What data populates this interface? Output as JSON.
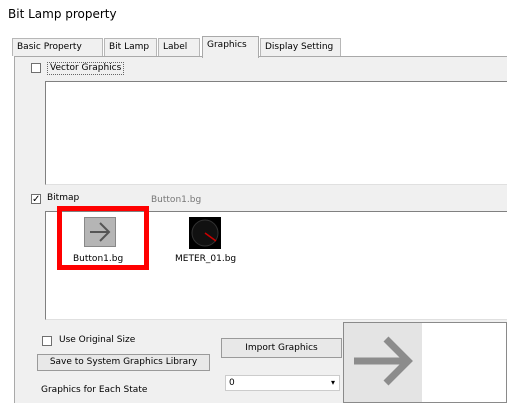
{
  "window": {
    "title": "Bit Lamp property"
  },
  "tabs": [
    {
      "label": "Basic Property",
      "active": false
    },
    {
      "label": "Bit Lamp",
      "active": false
    },
    {
      "label": "Label",
      "active": false
    },
    {
      "label": "Graphics",
      "active": true
    },
    {
      "label": "Display Setting",
      "active": false
    }
  ],
  "vector_graphics": {
    "label": "Vector Graphics",
    "checked": false
  },
  "bitmap": {
    "label": "Bitmap",
    "checked": true,
    "selected_file": "Button1.bg",
    "items": [
      {
        "name": "Button1.bg",
        "icon": "arrow-right-icon",
        "selected": true
      },
      {
        "name": "METER_01.bg",
        "icon": "meter-icon",
        "selected": false
      }
    ]
  },
  "options": {
    "use_original_size_label": "Use Original Size",
    "use_original_size_checked": false,
    "save_button_label": "Save to System Graphics Library",
    "import_button_label": "Import Graphics",
    "state_label": "Graphics for Each State",
    "state_value": "0"
  },
  "colors": {
    "highlight": "#ff0000",
    "panel": "#f0f0f0"
  }
}
